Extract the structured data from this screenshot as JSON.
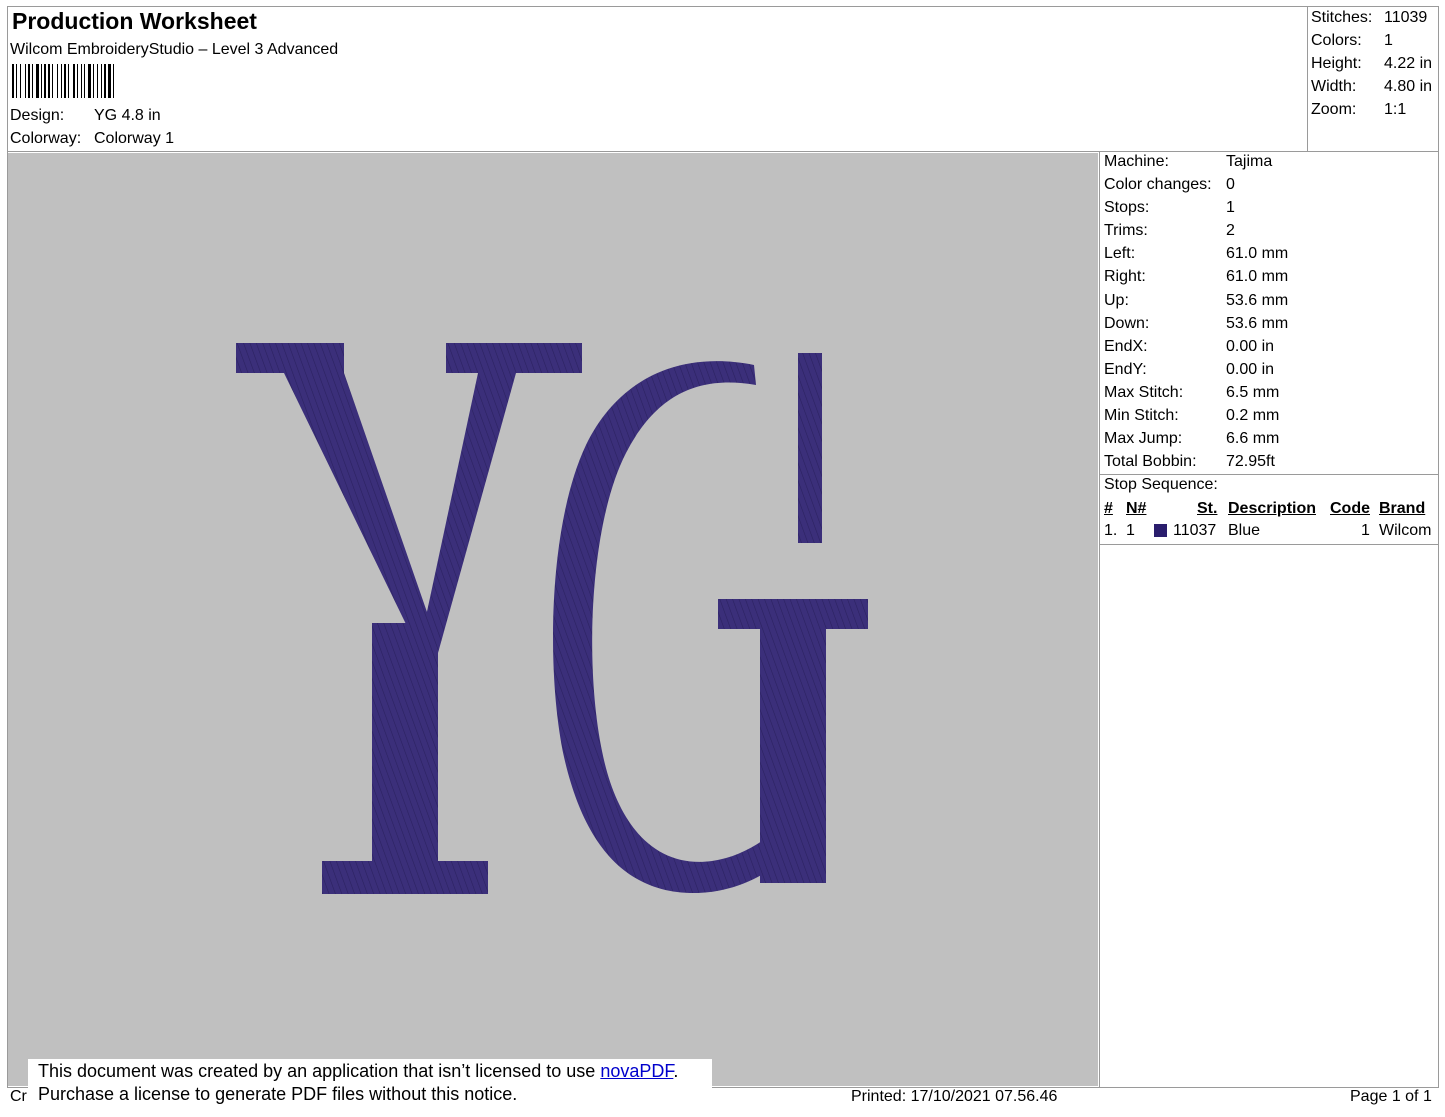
{
  "header": {
    "title": "Production Worksheet",
    "software": "Wilcom EmbroideryStudio – Level 3 Advanced",
    "design_label": "Design:",
    "design_value": "YG 4.8 in",
    "colorway_label": "Colorway:",
    "colorway_value": "Colorway 1"
  },
  "summary": [
    {
      "label": "Stitches:",
      "value": "11039"
    },
    {
      "label": "Colors:",
      "value": "1"
    },
    {
      "label": "Height:",
      "value": "4.22 in"
    },
    {
      "label": "Width:",
      "value": "4.80 in"
    },
    {
      "label": "Zoom:",
      "value": "1:1"
    }
  ],
  "design_preview": {
    "text": "YG",
    "thread_color": "#3b2f7a",
    "background_color": "#c0c0c0"
  },
  "machine_info": [
    {
      "label": "Machine:",
      "value": "Tajima"
    },
    {
      "label": "Color changes:",
      "value": "0"
    },
    {
      "label": "Stops:",
      "value": "1"
    },
    {
      "label": "Trims:",
      "value": "2"
    },
    {
      "label": "Left:",
      "value": "61.0 mm"
    },
    {
      "label": "Right:",
      "value": "61.0 mm"
    },
    {
      "label": "Up:",
      "value": "53.6 mm"
    },
    {
      "label": "Down:",
      "value": "53.6 mm"
    },
    {
      "label": "EndX:",
      "value": "0.00 in"
    },
    {
      "label": "EndY:",
      "value": "0.00 in"
    },
    {
      "label": "Max Stitch:",
      "value": "6.5 mm"
    },
    {
      "label": "Min Stitch:",
      "value": "0.2 mm"
    },
    {
      "label": "Max Jump:",
      "value": "6.6 mm"
    },
    {
      "label": "Total Bobbin:",
      "value": "72.95ft"
    }
  ],
  "stop_sequence": {
    "label": "Stop Sequence:",
    "columns": [
      "#",
      "N#",
      "St.",
      "Description",
      "Code",
      "Brand"
    ],
    "rows": [
      {
        "index": "1.",
        "needle": "1",
        "color": "#2a1d6d",
        "stitches": "11037",
        "description": "Blue",
        "code": "1",
        "brand": "Wilcom"
      }
    ]
  },
  "notice": {
    "line1_prefix": "This document was created by an application that isn’t licensed to use ",
    "link": "novaPDF",
    "line1_suffix": ".",
    "line2": "Purchase a license to generate PDF files without this notice."
  },
  "footer": {
    "left_fragment": "Cr",
    "printed": "Printed: 17/10/2021 07.56.46",
    "page": "Page 1 of 1"
  }
}
